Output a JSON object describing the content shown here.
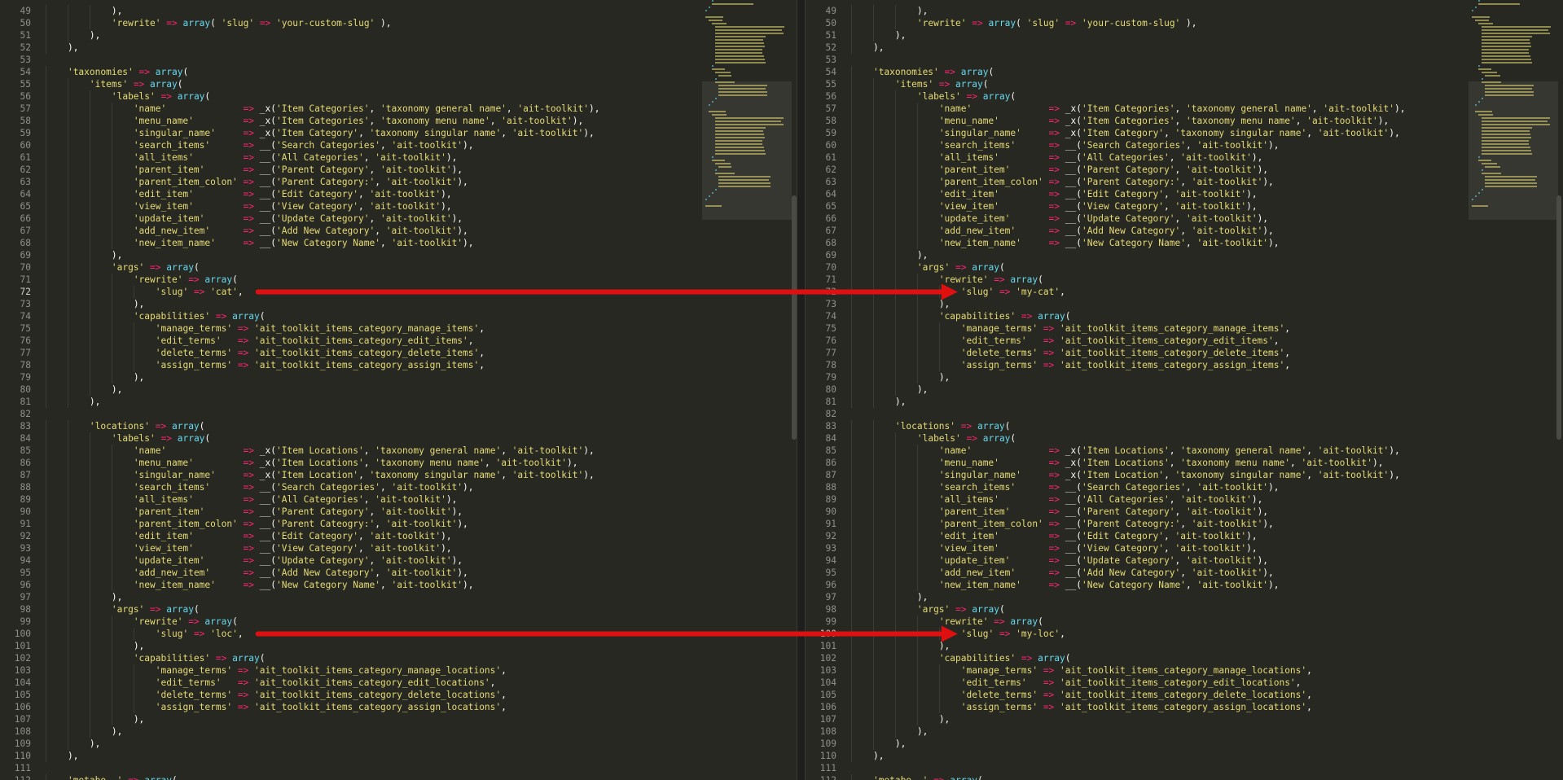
{
  "panes": [
    {
      "id": "left",
      "current_line": 72,
      "lines": [
        {
          "n": 49,
          "t": "            ),"
        },
        {
          "n": 50,
          "t": "            'rewrite' => array( 'slug' => 'your-custom-slug' ),"
        },
        {
          "n": 51,
          "t": "        ),"
        },
        {
          "n": 52,
          "t": "    ),"
        },
        {
          "n": 53,
          "t": ""
        },
        {
          "n": 54,
          "t": "    'taxonomies' => array("
        },
        {
          "n": 55,
          "t": "        'items' => array("
        },
        {
          "n": 56,
          "t": "            'labels' => array("
        },
        {
          "n": 57,
          "t": "                'name'              => _x('Item Categories', 'taxonomy general name', 'ait-toolkit'),"
        },
        {
          "n": 58,
          "t": "                'menu_name'         => _x('Item Categories', 'taxonomy menu name', 'ait-toolkit'),"
        },
        {
          "n": 59,
          "t": "                'singular_name'     => _x('Item Category', 'taxonomy singular name', 'ait-toolkit'),"
        },
        {
          "n": 60,
          "t": "                'search_items'      => __('Search Categories', 'ait-toolkit'),"
        },
        {
          "n": 61,
          "t": "                'all_items'         => __('All Categories', 'ait-toolkit'),"
        },
        {
          "n": 62,
          "t": "                'parent_item'       => __('Parent Category', 'ait-toolkit'),"
        },
        {
          "n": 63,
          "t": "                'parent_item_colon' => __('Parent Category:', 'ait-toolkit'),"
        },
        {
          "n": 64,
          "t": "                'edit_item'         => __('Edit Category', 'ait-toolkit'),"
        },
        {
          "n": 65,
          "t": "                'view_item'         => __('View Category', 'ait-toolkit'),"
        },
        {
          "n": 66,
          "t": "                'update_item'       => __('Update Category', 'ait-toolkit'),"
        },
        {
          "n": 67,
          "t": "                'add_new_item'      => __('Add New Category', 'ait-toolkit'),"
        },
        {
          "n": 68,
          "t": "                'new_item_name'     => __('New Category Name', 'ait-toolkit'),"
        },
        {
          "n": 69,
          "t": "            ),"
        },
        {
          "n": 70,
          "t": "            'args' => array("
        },
        {
          "n": 71,
          "t": "                'rewrite' => array("
        },
        {
          "n": 72,
          "t": "                    'slug' => 'cat',"
        },
        {
          "n": 73,
          "t": "                ),"
        },
        {
          "n": 74,
          "t": "                'capabilities' => array("
        },
        {
          "n": 75,
          "t": "                    'manage_terms' => 'ait_toolkit_items_category_manage_items',"
        },
        {
          "n": 76,
          "t": "                    'edit_terms'   => 'ait_toolkit_items_category_edit_items',"
        },
        {
          "n": 77,
          "t": "                    'delete_terms' => 'ait_toolkit_items_category_delete_items',"
        },
        {
          "n": 78,
          "t": "                    'assign_terms' => 'ait_toolkit_items_category_assign_items',"
        },
        {
          "n": 79,
          "t": "                ),"
        },
        {
          "n": 80,
          "t": "            ),"
        },
        {
          "n": 81,
          "t": "        ),"
        },
        {
          "n": 82,
          "t": ""
        },
        {
          "n": 83,
          "t": "        'locations' => array("
        },
        {
          "n": 84,
          "t": "            'labels' => array("
        },
        {
          "n": 85,
          "t": "                'name'              => _x('Item Locations', 'taxonomy general name', 'ait-toolkit'),"
        },
        {
          "n": 86,
          "t": "                'menu_name'         => _x('Item Locations', 'taxonomy menu name', 'ait-toolkit'),"
        },
        {
          "n": 87,
          "t": "                'singular_name'     => _x('Item Location', 'taxonomy singular name', 'ait-toolkit'),"
        },
        {
          "n": 88,
          "t": "                'search_items'      => __('Search Categories', 'ait-toolkit'),"
        },
        {
          "n": 89,
          "t": "                'all_items'         => __('All Categories', 'ait-toolkit'),"
        },
        {
          "n": 90,
          "t": "                'parent_item'       => __('Parent Category', 'ait-toolkit'),"
        },
        {
          "n": 91,
          "t": "                'parent_item_colon' => __('Parent Cateogry:', 'ait-toolkit'),"
        },
        {
          "n": 92,
          "t": "                'edit_item'         => __('Edit Category', 'ait-toolkit'),"
        },
        {
          "n": 93,
          "t": "                'view_item'         => __('View Category', 'ait-toolkit'),"
        },
        {
          "n": 94,
          "t": "                'update_item'       => __('Update Category', 'ait-toolkit'),"
        },
        {
          "n": 95,
          "t": "                'add_new_item'      => __('Add New Category', 'ait-toolkit'),"
        },
        {
          "n": 96,
          "t": "                'new_item_name'     => __('New Category Name', 'ait-toolkit'),"
        },
        {
          "n": 97,
          "t": "            ),"
        },
        {
          "n": 98,
          "t": "            'args' => array("
        },
        {
          "n": 99,
          "t": "                'rewrite' => array("
        },
        {
          "n": 100,
          "t": "                    'slug' => 'loc',"
        },
        {
          "n": 101,
          "t": "                ),"
        },
        {
          "n": 102,
          "t": "                'capabilities' => array("
        },
        {
          "n": 103,
          "t": "                    'manage_terms' => 'ait_toolkit_items_category_manage_locations',"
        },
        {
          "n": 104,
          "t": "                    'edit_terms'   => 'ait_toolkit_items_category_edit_locations',"
        },
        {
          "n": 105,
          "t": "                    'delete_terms' => 'ait_toolkit_items_category_delete_locations',"
        },
        {
          "n": 106,
          "t": "                    'assign_terms' => 'ait_toolkit_items_category_assign_locations',"
        },
        {
          "n": 107,
          "t": "                ),"
        },
        {
          "n": 108,
          "t": "            ),"
        },
        {
          "n": 109,
          "t": "        ),"
        },
        {
          "n": 110,
          "t": "    ),"
        },
        {
          "n": 111,
          "t": ""
        },
        {
          "n": 112,
          "t": "    'metabo..' => array("
        }
      ]
    },
    {
      "id": "right",
      "current_line": 100,
      "lines": [
        {
          "n": 49,
          "t": "            ),"
        },
        {
          "n": 50,
          "t": "            'rewrite' => array( 'slug' => 'your-custom-slug' ),"
        },
        {
          "n": 51,
          "t": "        ),"
        },
        {
          "n": 52,
          "t": "    ),"
        },
        {
          "n": 53,
          "t": ""
        },
        {
          "n": 54,
          "t": "    'taxonomies' => array("
        },
        {
          "n": 55,
          "t": "        'items' => array("
        },
        {
          "n": 56,
          "t": "            'labels' => array("
        },
        {
          "n": 57,
          "t": "                'name'              => _x('Item Categories', 'taxonomy general name', 'ait-toolkit'),"
        },
        {
          "n": 58,
          "t": "                'menu_name'         => _x('Item Categories', 'taxonomy menu name', 'ait-toolkit'),"
        },
        {
          "n": 59,
          "t": "                'singular_name'     => _x('Item Category', 'taxonomy singular name', 'ait-toolkit'),"
        },
        {
          "n": 60,
          "t": "                'search_items'      => __('Search Categories', 'ait-toolkit'),"
        },
        {
          "n": 61,
          "t": "                'all_items'         => __('All Categories', 'ait-toolkit'),"
        },
        {
          "n": 62,
          "t": "                'parent_item'       => __('Parent Category', 'ait-toolkit'),"
        },
        {
          "n": 63,
          "t": "                'parent_item_colon' => __('Parent Category:', 'ait-toolkit'),"
        },
        {
          "n": 64,
          "t": "                'edit_item'         => __('Edit Category', 'ait-toolkit'),"
        },
        {
          "n": 65,
          "t": "                'view_item'         => __('View Category', 'ait-toolkit'),"
        },
        {
          "n": 66,
          "t": "                'update_item'       => __('Update Category', 'ait-toolkit'),"
        },
        {
          "n": 67,
          "t": "                'add_new_item'      => __('Add New Category', 'ait-toolkit'),"
        },
        {
          "n": 68,
          "t": "                'new_item_name'     => __('New Category Name', 'ait-toolkit'),"
        },
        {
          "n": 69,
          "t": "            ),"
        },
        {
          "n": 70,
          "t": "            'args' => array("
        },
        {
          "n": 71,
          "t": "                'rewrite' => array("
        },
        {
          "n": 72,
          "t": "                    'slug' => 'my-cat',"
        },
        {
          "n": 73,
          "t": "                ),"
        },
        {
          "n": 74,
          "t": "                'capabilities' => array("
        },
        {
          "n": 75,
          "t": "                    'manage_terms' => 'ait_toolkit_items_category_manage_items',"
        },
        {
          "n": 76,
          "t": "                    'edit_terms'   => 'ait_toolkit_items_category_edit_items',"
        },
        {
          "n": 77,
          "t": "                    'delete_terms' => 'ait_toolkit_items_category_delete_items',"
        },
        {
          "n": 78,
          "t": "                    'assign_terms' => 'ait_toolkit_items_category_assign_items',"
        },
        {
          "n": 79,
          "t": "                ),"
        },
        {
          "n": 80,
          "t": "            ),"
        },
        {
          "n": 81,
          "t": "        ),"
        },
        {
          "n": 82,
          "t": ""
        },
        {
          "n": 83,
          "t": "        'locations' => array("
        },
        {
          "n": 84,
          "t": "            'labels' => array("
        },
        {
          "n": 85,
          "t": "                'name'              => _x('Item Locations', 'taxonomy general name', 'ait-toolkit'),"
        },
        {
          "n": 86,
          "t": "                'menu_name'         => _x('Item Locations', 'taxonomy menu name', 'ait-toolkit'),"
        },
        {
          "n": 87,
          "t": "                'singular_name'     => _x('Item Location', 'taxonomy singular name', 'ait-toolkit'),"
        },
        {
          "n": 88,
          "t": "                'search_items'      => __('Search Categories', 'ait-toolkit'),"
        },
        {
          "n": 89,
          "t": "                'all_items'         => __('All Categories', 'ait-toolkit'),"
        },
        {
          "n": 90,
          "t": "                'parent_item'       => __('Parent Category', 'ait-toolkit'),"
        },
        {
          "n": 91,
          "t": "                'parent_item_colon' => __('Parent Cateogry:', 'ait-toolkit'),"
        },
        {
          "n": 92,
          "t": "                'edit_item'         => __('Edit Category', 'ait-toolkit'),"
        },
        {
          "n": 93,
          "t": "                'view_item'         => __('View Category', 'ait-toolkit'),"
        },
        {
          "n": 94,
          "t": "                'update_item'       => __('Update Category', 'ait-toolkit'),"
        },
        {
          "n": 95,
          "t": "                'add_new_item'      => __('Add New Category', 'ait-toolkit'),"
        },
        {
          "n": 96,
          "t": "                'new_item_name'     => __('New Category Name', 'ait-toolkit'),"
        },
        {
          "n": 97,
          "t": "            ),"
        },
        {
          "n": 98,
          "t": "            'args' => array("
        },
        {
          "n": 99,
          "t": "                'rewrite' => array("
        },
        {
          "n": 100,
          "t": "                    'slug' => 'my-loc',"
        },
        {
          "n": 101,
          "t": "                ),"
        },
        {
          "n": 102,
          "t": "                'capabilities' => array("
        },
        {
          "n": 103,
          "t": "                    'manage_terms' => 'ait_toolkit_items_category_manage_locations',"
        },
        {
          "n": 104,
          "t": "                    'edit_terms'   => 'ait_toolkit_items_category_edit_locations',"
        },
        {
          "n": 105,
          "t": "                    'delete_terms' => 'ait_toolkit_items_category_delete_locations',"
        },
        {
          "n": 106,
          "t": "                    'assign_terms' => 'ait_toolkit_items_category_assign_locations',"
        },
        {
          "n": 107,
          "t": "                ),"
        },
        {
          "n": 108,
          "t": "            ),"
        },
        {
          "n": 109,
          "t": "        ),"
        },
        {
          "n": 110,
          "t": "    ),"
        },
        {
          "n": 111,
          "t": ""
        },
        {
          "n": 112,
          "t": "    'metabo..' => array("
        }
      ]
    }
  ],
  "annotations": [
    {
      "from_pane": "left",
      "from_line": 72,
      "to_pane": "right",
      "to_line": 72,
      "color": "#e01010"
    },
    {
      "from_pane": "left",
      "from_line": 100,
      "to_pane": "right",
      "to_line": 100,
      "color": "#e01010"
    }
  ],
  "colors": {
    "background": "#272822",
    "string": "#e6db74",
    "keyword": "#66d9ef",
    "operator": "#f92672",
    "line_number": "#8f908a",
    "arrow": "#e01010"
  }
}
